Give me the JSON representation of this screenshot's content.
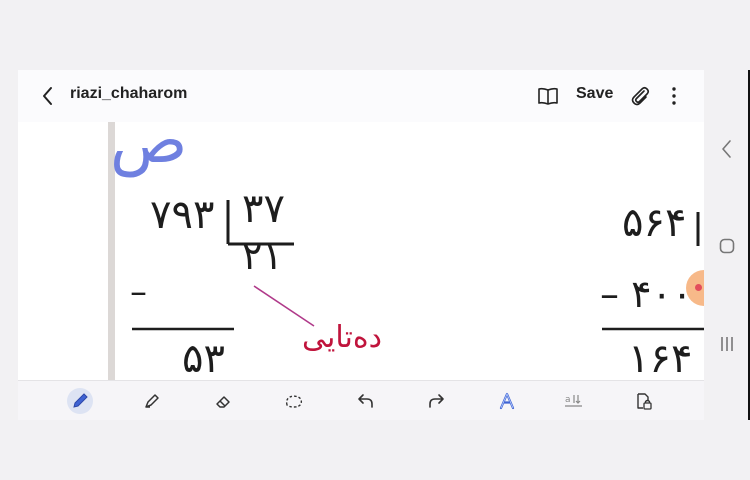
{
  "header": {
    "title": "riazi_chaharom",
    "save_label": "Save"
  },
  "canvas": {
    "letter_saad": "ص",
    "left_problem": {
      "dividend": "۷۹۳",
      "divisor": "۳۷",
      "quotient": "۲۱",
      "subtract_sign": "–",
      "remainder": "۵۳"
    },
    "annotation": "ده‌تایی",
    "right_problem": {
      "dividend": "۵۶۴",
      "subtract": "– ۴۰۰",
      "remainder": "۱۶۴"
    }
  },
  "colors": {
    "ink_black": "#1d1d1d",
    "ink_blue": "#6f80e0",
    "ink_red": "#c0143c",
    "line_magenta": "#b03a8a",
    "accent_active": "#3f63d3"
  },
  "toolbar": {
    "tools": [
      "pen-icon",
      "highlighter-icon",
      "eraser-icon",
      "lasso-icon",
      "undo-icon",
      "redo-icon",
      "text-style-icon",
      "text-convert-icon",
      "read-only-icon"
    ]
  },
  "system_nav": [
    "back-nav-icon",
    "home-nav-icon",
    "recents-nav-icon"
  ]
}
